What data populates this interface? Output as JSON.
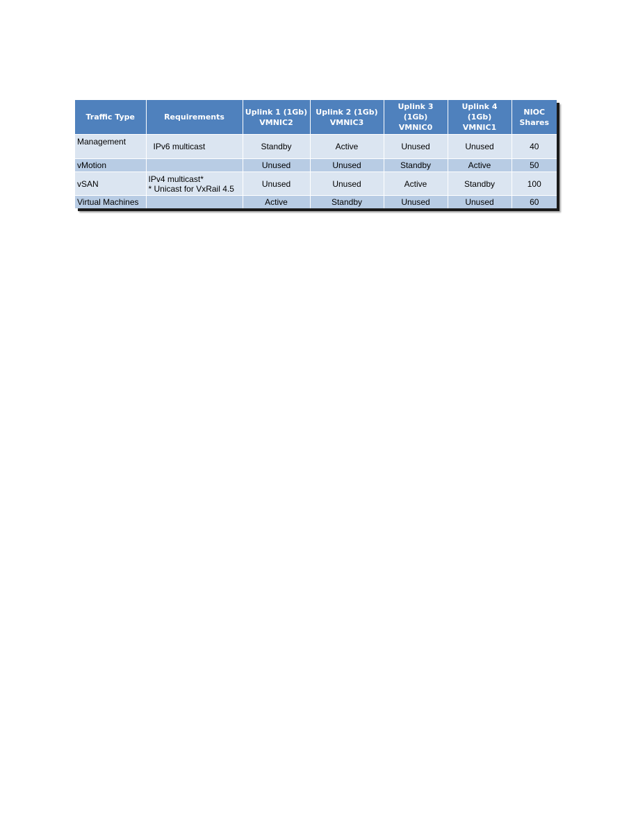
{
  "table": {
    "headers": [
      {
        "line1": "Traffic Type",
        "line2": ""
      },
      {
        "line1": "Requirements",
        "line2": ""
      },
      {
        "line1": "Uplink 1 (1Gb)",
        "line2": "VMNIC2"
      },
      {
        "line1": "Uplink 2 (1Gb)",
        "line2": "VMNIC3"
      },
      {
        "line1": "Uplink 3 (1Gb)",
        "line2": "VMNIC0"
      },
      {
        "line1": "Uplink 4 (1Gb)",
        "line2": "VMNIC1"
      },
      {
        "line1": "NIOC",
        "line2": "Shares"
      }
    ],
    "rows": [
      {
        "traffic_type": "Management",
        "requirements": [
          "IPv6 multicast"
        ],
        "uplink1": "Standby",
        "uplink2": "Active",
        "uplink3": "Unused",
        "uplink4": "Unused",
        "nioc_shares": "40"
      },
      {
        "traffic_type": "vMotion",
        "requirements": [
          ""
        ],
        "uplink1": "Unused",
        "uplink2": "Unused",
        "uplink3": "Standby",
        "uplink4": "Active",
        "nioc_shares": "50"
      },
      {
        "traffic_type": "vSAN",
        "requirements": [
          "IPv4 multicast*",
          "* Unicast for VxRail 4.5"
        ],
        "uplink1": "Unused",
        "uplink2": "Unused",
        "uplink3": "Active",
        "uplink4": "Standby",
        "nioc_shares": "100"
      },
      {
        "traffic_type": "Virtual Machines",
        "requirements": [
          ""
        ],
        "uplink1": "Active",
        "uplink2": "Standby",
        "uplink3": "Unused",
        "uplink4": "Unused",
        "nioc_shares": "60"
      }
    ]
  },
  "colors": {
    "header_bg": "#4f81bd",
    "row_light": "#dbe5f1",
    "row_dark": "#b8cce4"
  }
}
